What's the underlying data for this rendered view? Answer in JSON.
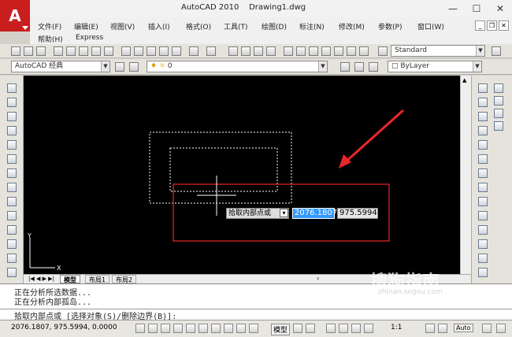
{
  "window": {
    "title": "AutoCAD 2010",
    "document": "Drawing1.dwg",
    "controls": [
      "—",
      "☐",
      "✕"
    ]
  },
  "menu": {
    "row1": [
      "文件(F)",
      "编辑(E)",
      "视图(V)",
      "插入(I)",
      "格式(O)",
      "工具(T)",
      "绘图(D)",
      "标注(N)",
      "修改(M)",
      "参数(P)",
      "窗口(W)"
    ],
    "row2": [
      "帮助(H)",
      "Express"
    ],
    "mdi_controls": [
      "_",
      "❐",
      "✕"
    ]
  },
  "toolbar": {
    "text_style": "Standard",
    "workspace": "AutoCAD 经典",
    "layer": "0",
    "color": "ByLayer"
  },
  "tabs": [
    "模型",
    "布局1",
    "布局2"
  ],
  "dynamic_input": {
    "prompt": "拾取内部点或",
    "x_value": "2076.1807",
    "y_value": "975.5994"
  },
  "command_history": [
    "正在分析所选数据...",
    "正在分析内部孤岛..."
  ],
  "command_prompt": "拾取内部点或 [选择对象(S)/删除边界(B)]:",
  "status": {
    "coordinates": "2076.1807, 975.5994, 0.0000",
    "model_label": "模型",
    "scale": "1:1",
    "auto": "Auto"
  },
  "watermark": {
    "main": "搜狗指南",
    "sub": "zhinan.sogou.com"
  },
  "colors": {
    "canvas": "#000000",
    "accent_red": "#e8272a",
    "logo_red": "#c81e1e",
    "highlight": "#3399ff"
  }
}
